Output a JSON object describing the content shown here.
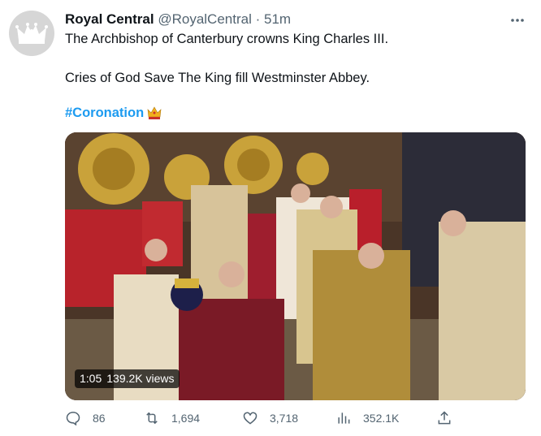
{
  "author": {
    "name": "Royal Central",
    "handle": "@RoyalCentral",
    "separator": "·",
    "time": "51m"
  },
  "tweet": {
    "line1": "The Archbishop of Canterbury crowns King Charles III.",
    "line2": "Cries of God Save The King fill Westminster Abbey.",
    "hashtag": "#Coronation"
  },
  "media": {
    "duration": "1:05",
    "views": "139.2K views"
  },
  "actions": {
    "replies": "86",
    "retweets": "1,694",
    "likes": "3,718",
    "views": "352.1K"
  },
  "colors": {
    "link": "#1d9bf0",
    "muted": "#536471",
    "text": "#0f1419"
  },
  "icons": [
    "crown-logo-icon",
    "more-icon",
    "crown-emoji-icon",
    "reply-icon",
    "retweet-icon",
    "like-icon",
    "views-icon",
    "share-icon"
  ]
}
